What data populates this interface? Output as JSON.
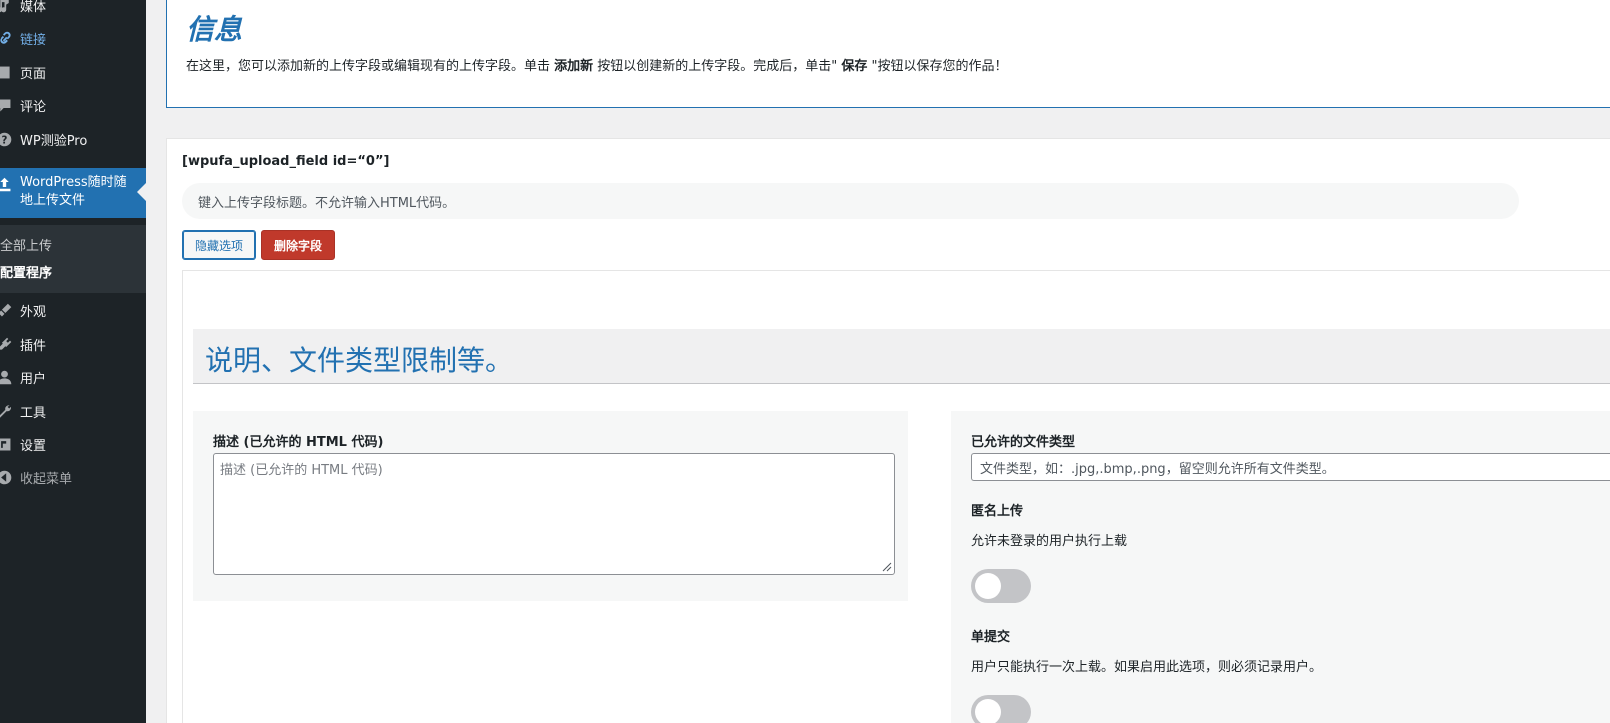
{
  "sidebar": {
    "items": [
      {
        "label": "媒体",
        "icon": "media-icon"
      },
      {
        "label": "链接",
        "icon": "link-icon"
      },
      {
        "label": "页面",
        "icon": "page-icon"
      },
      {
        "label": "评论",
        "icon": "comment-icon"
      },
      {
        "label": "WP测验Pro",
        "icon": "help-icon"
      },
      {
        "label": "WordPress随时随地上传文件",
        "icon": "upload-icon"
      },
      {
        "label": "外观",
        "icon": "brush-icon"
      },
      {
        "label": "插件",
        "icon": "plugin-icon"
      },
      {
        "label": "用户",
        "icon": "user-icon"
      },
      {
        "label": "工具",
        "icon": "wrench-icon"
      },
      {
        "label": "设置",
        "icon": "settings-icon"
      },
      {
        "label": "收起菜单",
        "icon": "collapse-icon"
      }
    ],
    "submenu": [
      "全部上传",
      "配置程序"
    ]
  },
  "info": {
    "title": "信息",
    "text_before": "在这里，您可以添加新的上传字段或编辑现有的上传字段。单击 ",
    "text_add": "添加新",
    "text_middle": " 按钮以创建新的上传字段。完成后，单击\" ",
    "text_save": "保存",
    "text_after": " \"按钮以保存您的作品！"
  },
  "field": {
    "shortcode": "[wpufa_upload_field id=“0”]",
    "title_placeholder": "键入上传字段标题。不允许输入HTML代码。",
    "hide_button": "隐藏选项",
    "delete_button": "删除字段",
    "section_title": "说明、文件类型限制等。",
    "description_label": "描述 (已允许的 HTML 代码)",
    "description_placeholder": "描述 (已允许的 HTML 代码)",
    "filetypes_label": "已允许的文件类型",
    "filetypes_placeholder": "文件类型，如：.jpg,.bmp,.png，留空则允许所有文件类型。",
    "anonymous_label": "匿名上传",
    "anonymous_desc": "允许未登录的用户执行上载",
    "single_label": "单提交",
    "single_desc": "用户只能执行一次上载。如果启用此选项，则必须记录用户。"
  },
  "colors": {
    "accent": "#2271b1",
    "sidebar_bg": "#1d2327",
    "danger": "#c0392b"
  }
}
